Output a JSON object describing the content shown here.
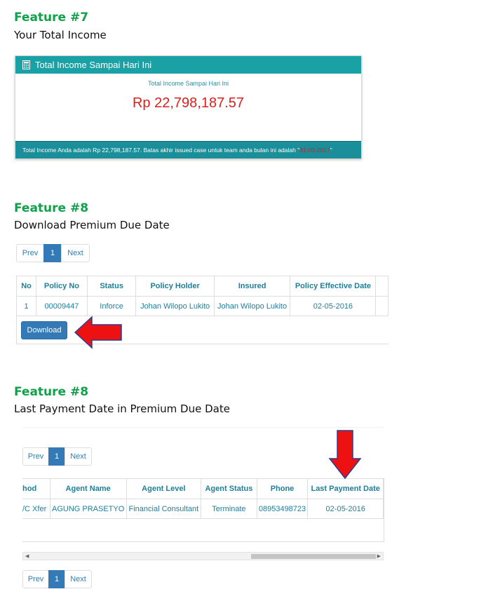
{
  "sections": [
    {
      "title": "Feature #7",
      "subtitle": "Your Total Income"
    },
    {
      "title": "Feature #8",
      "subtitle": "Download Premium Due Date"
    },
    {
      "title": "Feature #8",
      "subtitle": "Last Payment Date in Premium Due Date"
    }
  ],
  "income_panel": {
    "header": "Total Income Sampai Hari Ini",
    "label": "Total Income Sampai Hari Ini",
    "amount": "Rp 22,798,187.57",
    "footer_text": "Total Income Anda adalah Rp 22,798,187.57. Batas akhir issued case untuk team anda bulan ini adalah \"",
    "footer_date": "31-03-2017",
    "footer_end": "\"",
    "header_icon": "calculator-icon"
  },
  "pager": {
    "prev": "Prev",
    "page": "1",
    "next": "Next"
  },
  "premium_table": {
    "headers": [
      "No",
      "Policy No",
      "Status",
      "Policy Holder",
      "Insured",
      "Policy Effective Date"
    ],
    "rows": [
      [
        "1",
        "00009447",
        "Inforce",
        "Johan Wilopo Lukito",
        "Johan Wilopo Lukito",
        "02-05-2016"
      ]
    ]
  },
  "download_label": "Download",
  "payment_table": {
    "headers": [
      "hod",
      "Agent Name",
      "Agent Level",
      "Agent Status",
      "Phone",
      "Last Payment Date"
    ],
    "rows": [
      [
        "/C Xfer",
        "AGUNG PRASETYO",
        "Financial Consultant",
        "Terminate",
        "08953498723",
        "02-05-2016"
      ]
    ]
  },
  "colors": {
    "feature_title": "#12a04a",
    "panel_teal": "#1aa1a6",
    "amount_red": "#d9221c",
    "primary_blue": "#337ab7",
    "arrow_red": "#ee1111"
  }
}
